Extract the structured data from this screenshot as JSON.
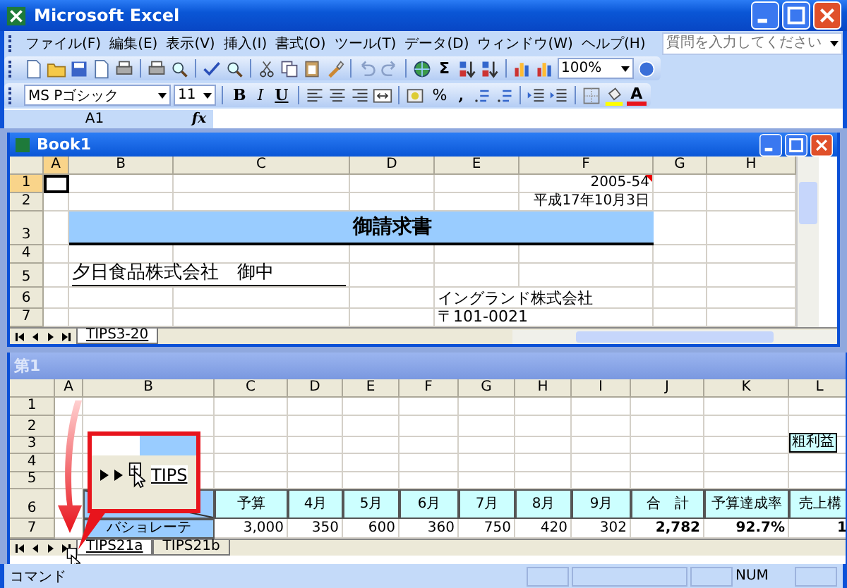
{
  "app_window": {
    "title": "Microsoft Excel"
  },
  "menu_bar": {
    "items": [
      "ファイル(F)",
      "編集(E)",
      "表示(V)",
      "挿入(I)",
      "書式(O)",
      "ツール(T)",
      "データ(D)",
      "ウィンドウ(W)",
      "ヘルプ(H)"
    ],
    "help_box": {
      "placeholder": "質問を入力してください"
    }
  },
  "standard_toolbar": {
    "sum_symbol": "Σ",
    "zoom": "100%"
  },
  "formatting_toolbar": {
    "font": "MS Pゴシック",
    "size": "11",
    "bold": "B",
    "italic": "I",
    "underline": "U",
    "percent": "%",
    "comma": ",",
    "font_color": "A"
  },
  "formula_bar": {
    "name_box": "A1",
    "function_label": "fx"
  },
  "workbooks": [
    {
      "title": "Book1",
      "columns": [
        {
          "label": "A",
          "selected": true
        },
        {
          "label": "B",
          "selected": false
        },
        {
          "label": "C",
          "selected": false
        },
        {
          "label": "D",
          "selected": false
        },
        {
          "label": "E",
          "selected": false
        },
        {
          "label": "F",
          "selected": false
        },
        {
          "label": "G",
          "selected": false
        },
        {
          "label": "H",
          "selected": false
        }
      ],
      "rows": [
        {
          "label": "1",
          "selected": true,
          "cells": [
            "",
            "",
            "",
            "",
            "",
            {
              "text": "2005-54",
              "kind": "number",
              "comment": true
            }
          ]
        },
        {
          "label": "2",
          "selected": false,
          "cells": [
            "",
            "",
            "",
            "",
            "",
            {
              "text": "平成17年10月3日",
              "kind": "number"
            }
          ]
        },
        {
          "label": "3",
          "selected": false,
          "cells": [
            "",
            {
              "text": "",
              "kind": "title"
            },
            {
              "text": "",
              "kind": "title"
            },
            {
              "text": "御請求書",
              "kind": "title"
            },
            {
              "text": "",
              "kind": "title"
            },
            {
              "text": "",
              "kind": "title"
            }
          ]
        },
        {
          "label": "4",
          "selected": false,
          "cells": []
        },
        {
          "label": "5",
          "selected": false,
          "cells": [
            "",
            {
              "text": "夕日食品株式会社　御中",
              "kind": "addressee"
            }
          ]
        },
        {
          "label": "6",
          "selected": false,
          "cells": [
            "",
            "",
            "",
            "",
            {
              "text": "イングランド株式会社",
              "kind": "company"
            }
          ]
        },
        {
          "label": "7",
          "selected": false,
          "cells": [
            "",
            "",
            "",
            "",
            {
              "text": "〒101-0021",
              "kind": "company"
            }
          ]
        }
      ],
      "sheet_tabs": [
        {
          "label": "TIPS3-20",
          "selected": true
        }
      ]
    },
    {
      "title": "第1",
      "columns": [
        {
          "label": "A",
          "selected": false
        },
        {
          "label": "B",
          "selected": false
        },
        {
          "label": "C",
          "selected": false
        },
        {
          "label": "D",
          "selected": false
        },
        {
          "label": "E",
          "selected": false
        },
        {
          "label": "F",
          "selected": false
        },
        {
          "label": "G",
          "selected": false
        },
        {
          "label": "H",
          "selected": false
        },
        {
          "label": "I",
          "selected": false
        },
        {
          "label": "J",
          "selected": false
        },
        {
          "label": "K",
          "selected": false
        },
        {
          "label": "L",
          "selected": false
        }
      ],
      "rows": [
        {
          "label": "1",
          "selected": false,
          "cells": []
        },
        {
          "label": "2",
          "selected": false,
          "cells": []
        },
        {
          "label": "3",
          "selected": false,
          "cells": [
            "",
            "",
            "",
            "",
            "",
            "",
            "",
            "",
            "",
            "",
            "",
            {
              "text": "粗利益",
              "kind": "label_box"
            }
          ]
        },
        {
          "label": "4",
          "selected": false,
          "cells": []
        },
        {
          "label": "5",
          "selected": false,
          "cells": []
        },
        {
          "label": "6",
          "selected": false,
          "cells": [
            "",
            {
              "text": "",
              "kind": "corner"
            },
            {
              "text": "予算",
              "kind": "header"
            },
            {
              "text": "4月",
              "kind": "header"
            },
            {
              "text": "5月",
              "kind": "header"
            },
            {
              "text": "6月",
              "kind": "header"
            },
            {
              "text": "7月",
              "kind": "header"
            },
            {
              "text": "8月",
              "kind": "header"
            },
            {
              "text": "9月",
              "kind": "header"
            },
            {
              "text": "合　計",
              "kind": "header"
            },
            {
              "text": "予算達成率",
              "kind": "header"
            },
            {
              "text": "売上構",
              "kind": "header"
            }
          ]
        },
        {
          "label": "7",
          "selected": false,
          "cells": [
            "",
            {
              "text": "バショレーテ",
              "kind": "row_label"
            },
            {
              "text": "3,000",
              "kind": "number"
            },
            {
              "text": "350",
              "kind": "number"
            },
            {
              "text": "600",
              "kind": "number"
            },
            {
              "text": "360",
              "kind": "number"
            },
            {
              "text": "750",
              "kind": "number"
            },
            {
              "text": "420",
              "kind": "number"
            },
            {
              "text": "302",
              "kind": "number"
            },
            {
              "text": "2,782",
              "kind": "bold_number"
            },
            {
              "text": "92.7%",
              "kind": "bold_number"
            },
            {
              "text": "1",
              "kind": "bold_number"
            }
          ]
        }
      ],
      "sheet_tabs": [
        {
          "label": "TIPS21a",
          "selected": true
        },
        {
          "label": "TIPS21b",
          "selected": false
        }
      ],
      "callout": {
        "tab": "TIPS"
      }
    }
  ],
  "status_bar": {
    "mode": "コマンド",
    "indicator": "NUM"
  }
}
